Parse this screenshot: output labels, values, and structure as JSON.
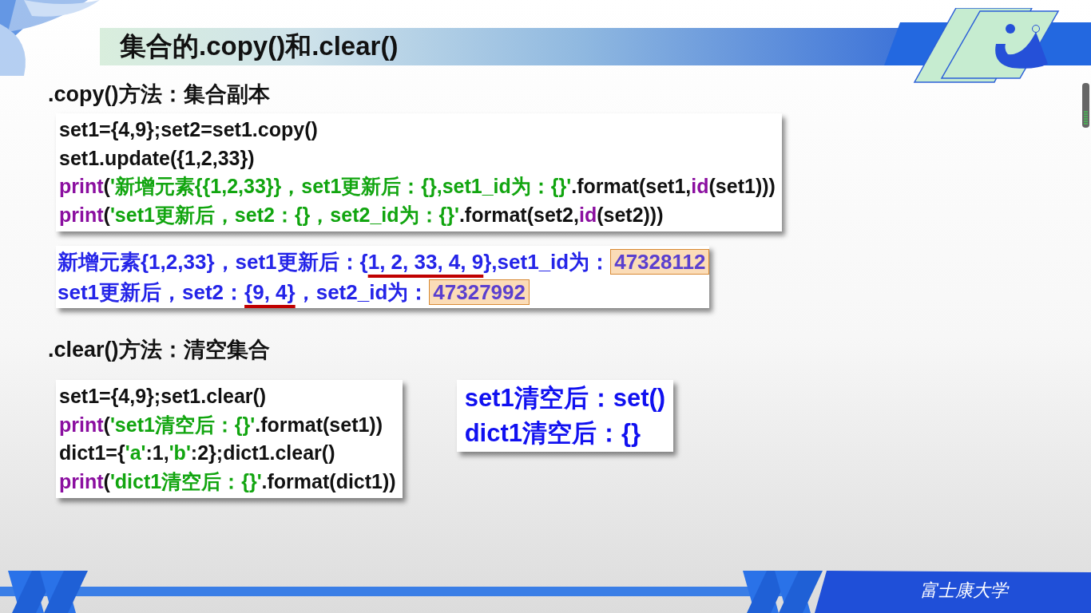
{
  "title": "集合的.copy()和.clear()",
  "sections": [
    {
      "heading": ".copy()方法：集合副本",
      "code": [
        [
          {
            "text": "set1={4,9};set2=set1.copy()",
            "kind": "plain"
          }
        ],
        [
          {
            "text": "set1.update({1,2,33})",
            "kind": "plain"
          }
        ],
        [
          {
            "text": "print",
            "kind": "keyword"
          },
          {
            "text": "(",
            "kind": "plain"
          },
          {
            "text": "'新增元素{{1,2,33}}，set1更新后：{},set1_id为：{}'",
            "kind": "string"
          },
          {
            "text": ".format(set1,",
            "kind": "plain"
          },
          {
            "text": "id",
            "kind": "keyword"
          },
          {
            "text": "(set1)))",
            "kind": "plain"
          }
        ],
        [
          {
            "text": "print",
            "kind": "keyword"
          },
          {
            "text": "(",
            "kind": "plain"
          },
          {
            "text": "'set1更新后，set2：{}，set2_id为：{}'",
            "kind": "string"
          },
          {
            "text": ".format(set2,",
            "kind": "plain"
          },
          {
            "text": "id",
            "kind": "keyword"
          },
          {
            "text": "(set2)))",
            "kind": "plain"
          }
        ]
      ],
      "output": [
        [
          {
            "text": "新增元素{1,2,33}，set1更新后：{",
            "kind": "plain"
          },
          {
            "text": "1, 2, 33, 4, 9",
            "kind": "underlined"
          },
          {
            "text": "},set1_id为：",
            "kind": "plain"
          },
          {
            "text": "47328112",
            "kind": "highlighted"
          }
        ],
        [
          {
            "text": "set1更新后，set2：",
            "kind": "plain"
          },
          {
            "text": "{9, 4}",
            "kind": "underlined"
          },
          {
            "text": "，set2_id为：",
            "kind": "plain"
          },
          {
            "text": "47327992",
            "kind": "highlighted"
          }
        ]
      ]
    },
    {
      "heading": ".clear()方法：清空集合",
      "code": [
        [
          {
            "text": "set1={4,9};set1.clear()",
            "kind": "plain"
          }
        ],
        [
          {
            "text": "print",
            "kind": "keyword"
          },
          {
            "text": "(",
            "kind": "plain"
          },
          {
            "text": "'set1清空后：{}'",
            "kind": "string"
          },
          {
            "text": ".format(set1))",
            "kind": "plain"
          }
        ],
        [
          {
            "text": "dict1={",
            "kind": "plain"
          },
          {
            "text": "'a'",
            "kind": "string"
          },
          {
            "text": ":1,",
            "kind": "plain"
          },
          {
            "text": "'b'",
            "kind": "string"
          },
          {
            "text": ":2};dict1.clear()",
            "kind": "plain"
          }
        ],
        [
          {
            "text": "print",
            "kind": "keyword"
          },
          {
            "text": "(",
            "kind": "plain"
          },
          {
            "text": "'dict1清空后：{}'",
            "kind": "string"
          },
          {
            "text": ".format(dict1))",
            "kind": "plain"
          }
        ]
      ],
      "output": [
        [
          {
            "text": "set1清空后：set()",
            "kind": "plain"
          }
        ],
        [
          {
            "text": "dict1清空后：{}",
            "kind": "plain"
          }
        ]
      ]
    }
  ],
  "footer_brand": "富士康大学"
}
